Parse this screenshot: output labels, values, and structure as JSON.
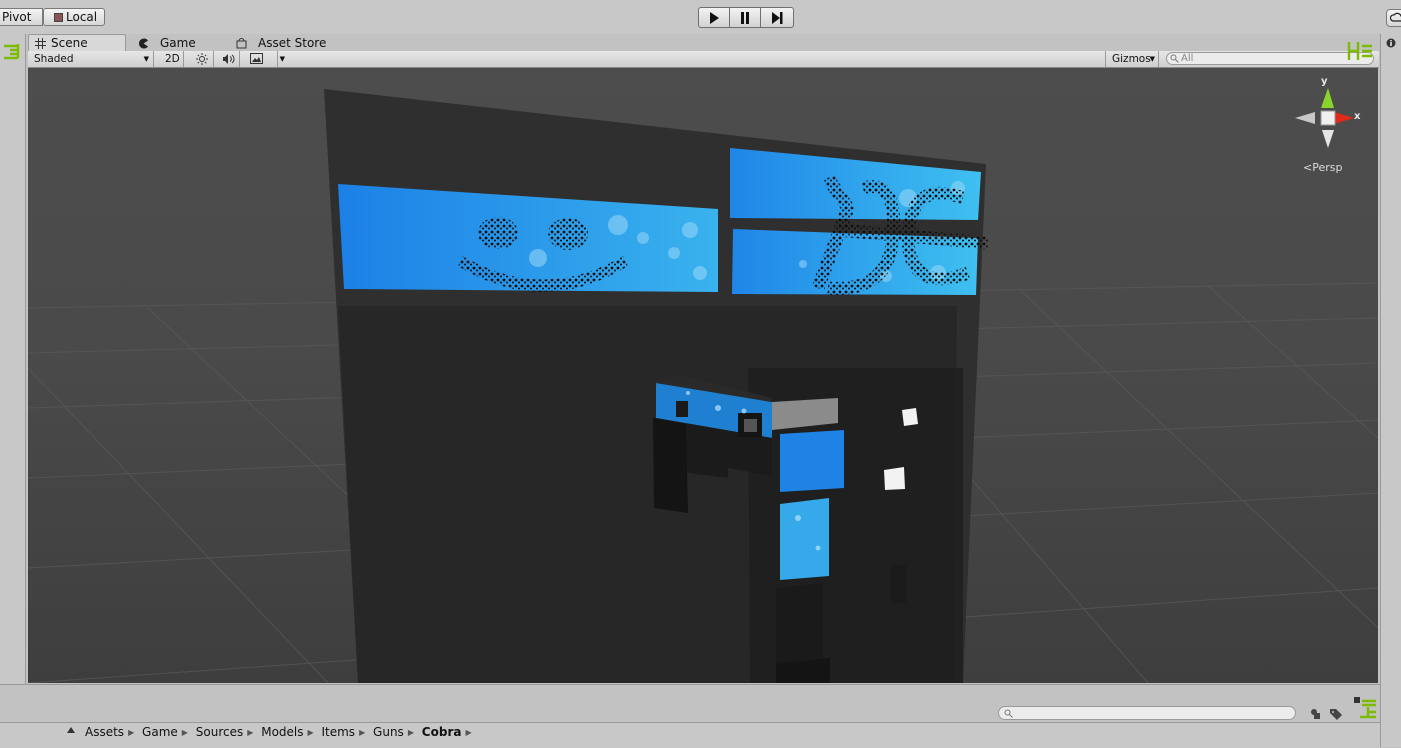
{
  "toolbar": {
    "pivot_label": "Pivot",
    "local_label": "Local",
    "play_icon": "play-icon",
    "pause_icon": "pause-icon",
    "step_icon": "step-icon"
  },
  "tabs": [
    {
      "label": "Scene",
      "icon": "grid-icon",
      "active": true
    },
    {
      "label": "Game",
      "icon": "pacman-icon",
      "active": false
    },
    {
      "label": "Asset Store",
      "icon": "store-icon",
      "active": false
    }
  ],
  "scene_toolbar": {
    "render_mode": "Shaded",
    "toggle_2d": "2D",
    "gizmos": "Gizmos",
    "search_placeholder": "All"
  },
  "orientation_gizmo": {
    "y_label": "y",
    "x_label": "x",
    "projection": "Persp"
  },
  "breadcrumb": [
    "Assets",
    "Game",
    "Sources",
    "Models",
    "Items",
    "Guns",
    "Cobra"
  ],
  "colors": {
    "accent_green": "#7dbb00",
    "screen_blue": "#1f87e8",
    "viewport_bg": "#474747",
    "gizmo_red": "#e0291b",
    "gizmo_green": "#8ad52b"
  }
}
